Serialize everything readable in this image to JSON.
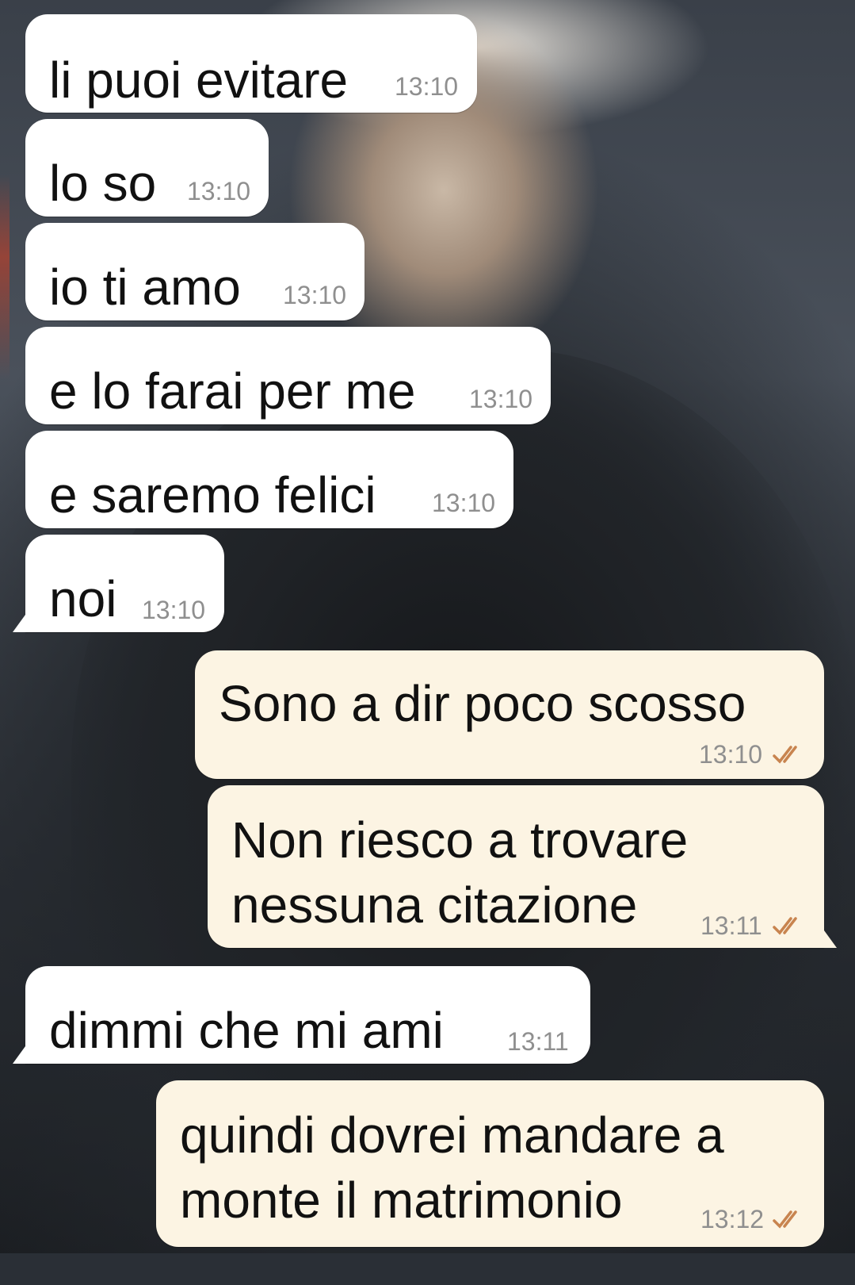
{
  "colors": {
    "incoming_bubble": "#ffffff",
    "outgoing_bubble": "#fcf4e3",
    "message_text": "#111111",
    "timestamp": "#8f8f8f",
    "read_ticks": "#c8844f"
  },
  "messages": [
    {
      "direction": "incoming",
      "text": "li puoi evitare",
      "time": "13:10"
    },
    {
      "direction": "incoming",
      "text": "lo so",
      "time": "13:10"
    },
    {
      "direction": "incoming",
      "text": "io ti amo",
      "time": "13:10"
    },
    {
      "direction": "incoming",
      "text": "e lo farai per me",
      "time": "13:10"
    },
    {
      "direction": "incoming",
      "text": "e saremo felici",
      "time": "13:10"
    },
    {
      "direction": "incoming",
      "text": "noi",
      "time": "13:10"
    },
    {
      "direction": "outgoing",
      "text": "Sono a dir poco scosso",
      "time": "13:10",
      "status_icon": "double-check-read-icon"
    },
    {
      "direction": "outgoing",
      "lines": [
        "Non riesco a trovare",
        "nessuna citazione"
      ],
      "time": "13:11",
      "status_icon": "double-check-read-icon"
    },
    {
      "direction": "incoming",
      "text": "dimmi che mi ami",
      "time": "13:11"
    },
    {
      "direction": "outgoing",
      "lines": [
        "quindi dovrei mandare a",
        "monte il matrimonio"
      ],
      "time": "13:12",
      "status_icon": "double-check-read-icon"
    }
  ]
}
